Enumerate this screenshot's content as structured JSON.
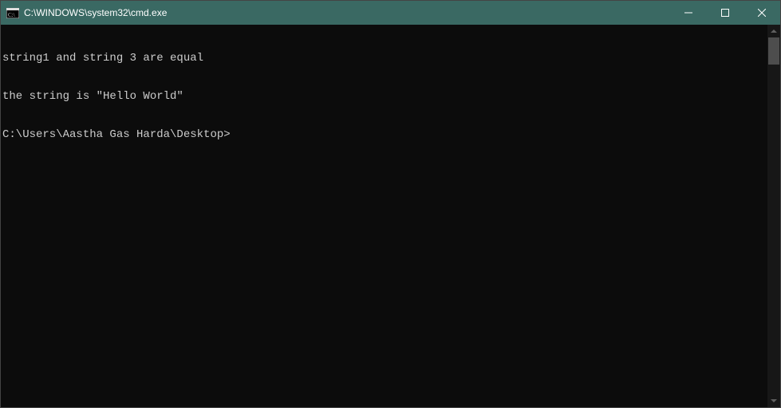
{
  "titlebar": {
    "title": "C:\\WINDOWS\\system32\\cmd.exe"
  },
  "terminal": {
    "lines": [
      "string1 and string 3 are equal",
      "the string is \"Hello World\"",
      "C:\\Users\\Aastha Gas Harda\\Desktop>"
    ]
  }
}
